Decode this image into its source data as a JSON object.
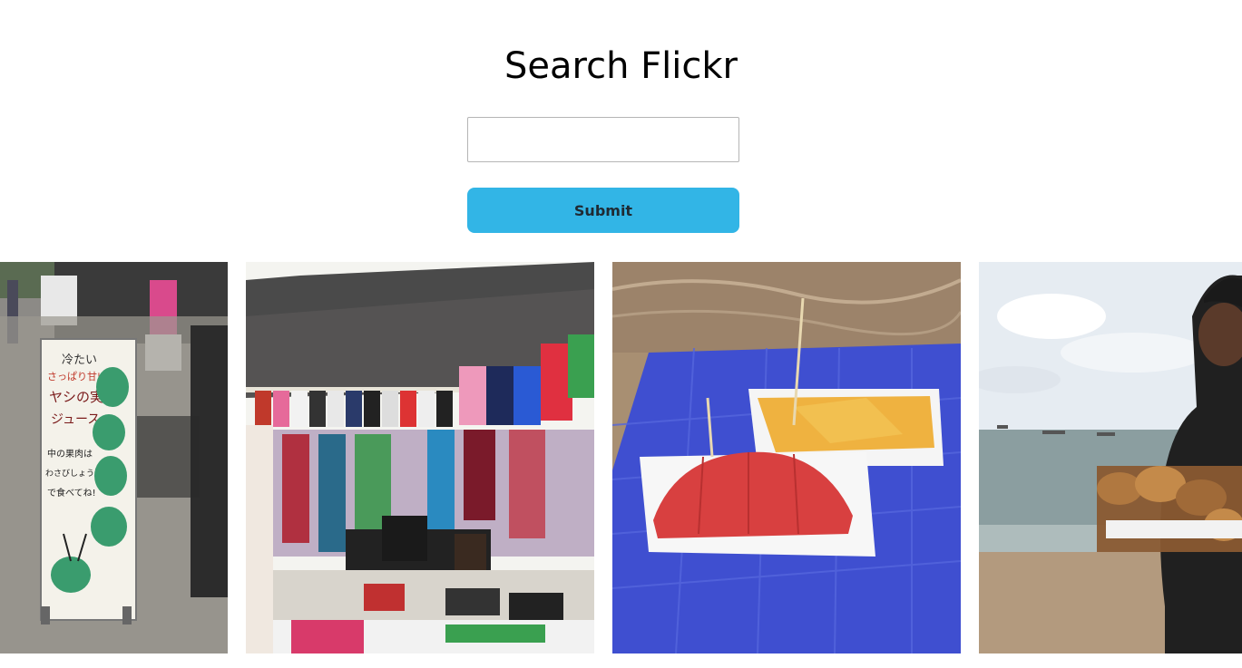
{
  "header": {
    "title": "Search Flickr"
  },
  "search": {
    "placeholder": "",
    "value": ""
  },
  "form": {
    "submit_label": "Submit"
  },
  "gallery": {
    "photos": [
      {
        "sign_lines": [
          "冷たい",
          "さっぱり甘い",
          "ヤシの実",
          "ジュース",
          "中の果肉は",
          "わさびしょう油",
          "で食べてね!"
        ]
      },
      {},
      {},
      {}
    ]
  },
  "colors": {
    "accent": "#32b5e6",
    "button_text": "#1f2a33",
    "input_border": "#b5b5b5"
  }
}
